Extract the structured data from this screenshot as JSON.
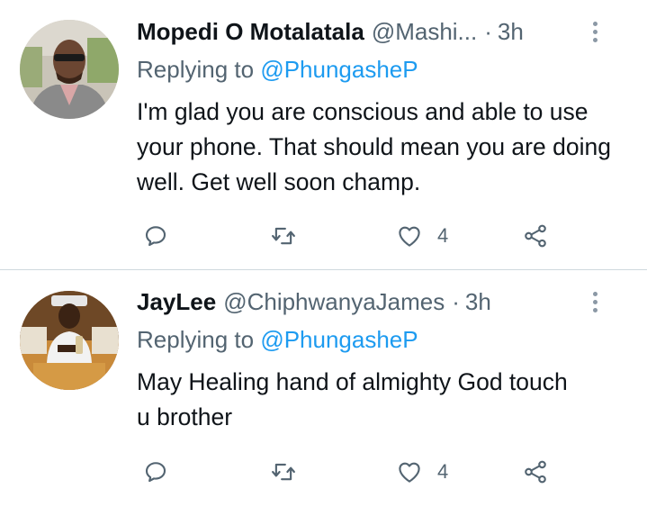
{
  "tweets": [
    {
      "author_name": "Mopedi O Motalatala",
      "handle": "@Mashi...",
      "separator": "·",
      "time": "3h",
      "replying_prefix": "Replying to",
      "replying_to": "@PhungasheP",
      "text": "I'm glad you are conscious and able to use your phone. That should mean you are doing well. Get well soon champ.",
      "like_count": "4"
    },
    {
      "author_name": "JayLee",
      "handle": "@ChiphwanyaJames",
      "separator": "·",
      "time": "3h",
      "replying_prefix": "Replying to",
      "replying_to": "@PhungasheP",
      "text": "May Healing hand of almighty God touch u brother",
      "like_count": "4"
    }
  ],
  "icons": {
    "reply": "reply-icon",
    "retweet": "retweet-icon",
    "like": "heart-icon",
    "share": "share-icon",
    "more": "more-options-icon"
  },
  "colors": {
    "link": "#1d9bf0",
    "secondary_text": "#536471",
    "primary_text": "#0f1419",
    "divider": "#cfd9de"
  }
}
